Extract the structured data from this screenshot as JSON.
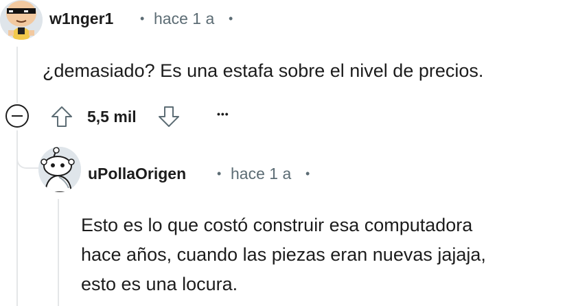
{
  "comments": [
    {
      "author": "w1nger1",
      "separator": "•",
      "time": "hace 1 a",
      "trailing": "•",
      "body": "¿demasiado? Es una estafa sobre el nivel de precios.",
      "votes": "5,5 mil",
      "avatar_icon": "avatar-sunglasses-icon"
    },
    {
      "author": "uPollaOrigen",
      "separator": "•",
      "time": "hace 1 a",
      "trailing": "•",
      "body_lines": [
        "Esto es lo que costó construir esa computadora",
        "hace años, cuando las piezas eran nuevas jajaja,",
        "esto es una locura."
      ],
      "avatar_icon": "avatar-snoo-icon"
    }
  ],
  "actions": {
    "more_label": "•••",
    "collapse_icon": "collapse-minus-icon",
    "upvote_icon": "upvote-arrow-icon",
    "downvote_icon": "downvote-arrow-icon"
  },
  "colors": {
    "text": "#1c1c1c",
    "meta": "#5c6c74",
    "thread_line": "#e4e6e8"
  }
}
